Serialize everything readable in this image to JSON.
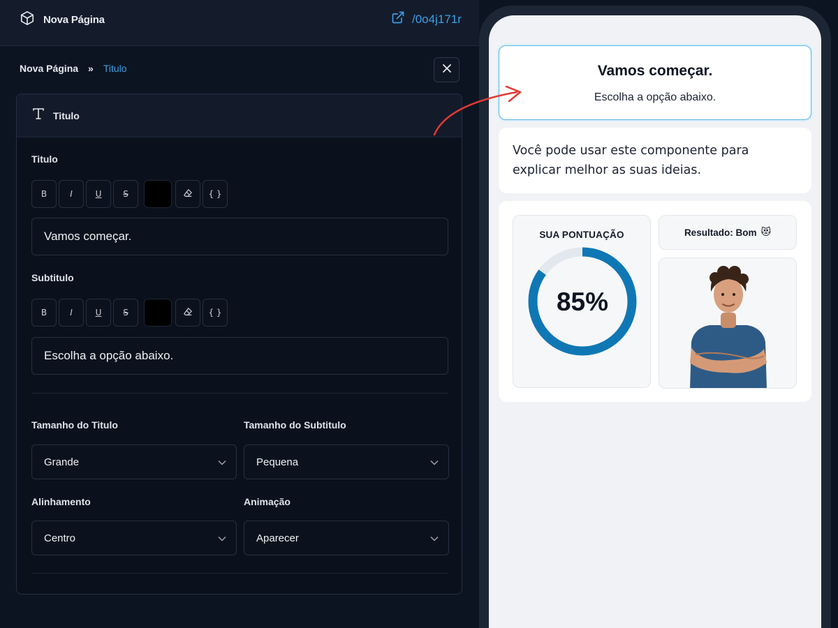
{
  "topbar": {
    "page_name": "Nova Página",
    "link_text": "/0o4j171r"
  },
  "breadcrumb": {
    "root": "Nova Página",
    "separator": "»",
    "current": "Titulo"
  },
  "panel": {
    "header": "Titulo",
    "title_label": "Titulo",
    "title_value": "Vamos começar.",
    "subtitle_label": "Subtitulo",
    "subtitle_value": "Escolha a opção abaixo.",
    "format_buttons": [
      "B",
      "I",
      "U",
      "S"
    ],
    "title_color": "#000000",
    "subtitle_color": "#000000",
    "variable_label": "{ }",
    "title_size_label": "Tamanho do Titulo",
    "title_size_value": "Grande",
    "subtitle_size_label": "Tamanho do Subtitulo",
    "subtitle_size_value": "Pequena",
    "alignment_label": "Alinhamento",
    "alignment_value": "Centro",
    "animation_label": "Animação",
    "animation_value": "Aparecer"
  },
  "preview": {
    "title": "Vamos começar.",
    "subtitle": "Escolha a opção abaixo.",
    "text": "Você pode usar este componente para explicar melhor as suas ideias.",
    "score_label": "SUA PONTUAÇÃO",
    "score_text": "85%",
    "score_fraction": 0.85,
    "result_text": "Resultado: Bom",
    "result_emoji": "😻"
  },
  "colors": {
    "accent": "#3aa0e6",
    "ring": "#1077b5",
    "ring_track": "#e3e8ef",
    "arrow": "#e53935"
  }
}
